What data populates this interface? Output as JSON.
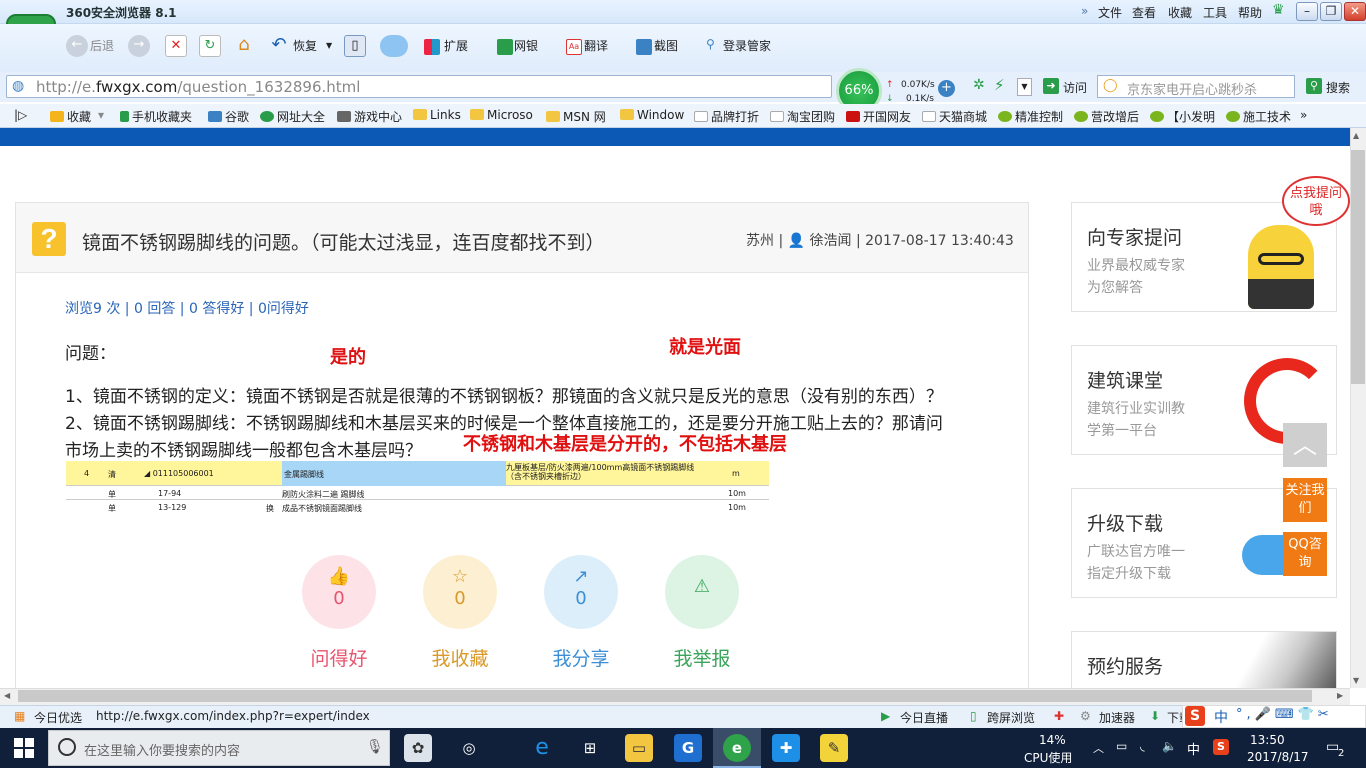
{
  "browser": {
    "app_title": "360安全浏览器 8.1",
    "logo_letter": "e",
    "menu": [
      "文件",
      "查看",
      "收藏",
      "工具",
      "帮助"
    ],
    "toolbar": {
      "back": "后退",
      "restore": "恢复",
      "extend": "扩展",
      "bank": "网银",
      "translate": "翻译",
      "screenshot": "截图",
      "login": "登录管家"
    },
    "address_prefix": "http://e.",
    "address_domain": "fwxgx.com",
    "address_path": "/question_1632896.html",
    "speed": {
      "percent": "66%",
      "up": "0.07K/s",
      "down": "0.1K/s"
    },
    "visit": "访问",
    "search_placeholder": "京东家电开启心跳秒杀",
    "search_button": "搜索",
    "bookmarks": [
      "收藏",
      "手机收藏夹",
      "谷歌",
      "网址大全",
      "游戏中心",
      "Links",
      "Microso",
      "MSN 网",
      "Window",
      "品牌打折",
      "淘宝团购",
      "开国网友",
      "天猫商城",
      "精准控制",
      "营改增后",
      "【小发明",
      "施工技术"
    ]
  },
  "question": {
    "icon_char": "?",
    "title": "镜面不锈钢踢脚线的问题。（可能太过浅显，连百度都找不到）",
    "location": "苏州",
    "author": "徐浩闻",
    "datetime": "2017-08-17 13:40:43",
    "stats": {
      "views": "浏览9 次",
      "answers": "0 回答",
      "likes": "0 答得好",
      "good": "0问得好"
    },
    "label": "问题：",
    "line1": "1、镜面不锈钢的定义：镜面不锈钢是否就是很薄的不锈钢钢板？那镜面的含义就只是反光的意思（没有别的东西）？",
    "line2": "2、镜面不锈钢踢脚线：不锈钢踢脚线和木基层买来的时候是一个整体直接施工的，还是要分开施工贴上去的？那请问",
    "line3": "市场上卖的不锈钢踢脚线一般都包含木基层吗？",
    "annotations": {
      "yes": "是的",
      "polished": "就是光面",
      "separate": "不锈钢和木基层是分开的，不包括木基层"
    },
    "sheet": {
      "header": {
        "no": "4",
        "type": "清",
        "code": "◢ 011105006001",
        "name": "金属踢脚线",
        "desc": "九厘板基层/防火漆两遍/100mm高镜面不锈钢踢脚线（含不锈钢夹槽折边）",
        "unit": "m"
      },
      "rows": [
        {
          "type": "单",
          "code": "17-94",
          "mark": "",
          "name": "刷防火涂料二遍 踢脚线",
          "unit": "10m"
        },
        {
          "type": "单",
          "code": "13-129",
          "mark": "换",
          "name": "成品不锈钢镜面踢脚线",
          "unit": "10m"
        }
      ]
    },
    "actions": [
      {
        "label": "问得好",
        "count": "0",
        "icon": "thumbs-up-icon",
        "glyph": "👍",
        "bg": "#fde3e8",
        "fg": "#e8546e"
      },
      {
        "label": "我收藏",
        "count": "0",
        "icon": "star-icon",
        "glyph": "☆",
        "bg": "#fdf0d2",
        "fg": "#d99a2a"
      },
      {
        "label": "我分享",
        "count": "0",
        "icon": "share-icon",
        "glyph": "↗",
        "bg": "#ddeefb",
        "fg": "#3c8fd6"
      },
      {
        "label": "我举报",
        "count": "",
        "icon": "warning-icon",
        "glyph": "⚠",
        "bg": "#ddf4e4",
        "fg": "#3aa55a"
      }
    ]
  },
  "sidebar": {
    "bubble": "点我提问哦",
    "cards": [
      {
        "title": "向专家提问",
        "desc1": "业界最权威专家",
        "desc2": "为您解答"
      },
      {
        "title": "建筑课堂",
        "desc1": "建筑行业实训教",
        "desc2": "学第一平台"
      },
      {
        "title": "升级下载",
        "desc1": "广联达官方唯一",
        "desc2": "指定升级下载"
      },
      {
        "title": "预约服务",
        "desc1": "",
        "desc2": ""
      }
    ],
    "float_follow": "关注我们",
    "float_qq": "QQ咨询"
  },
  "status": {
    "today": "今日优选",
    "url": "http://e.fwxgx.com/index.php?r=expert/index",
    "live": "今日直播",
    "cross_screen": "跨屏浏览",
    "accelerator": "加速器",
    "download": "下载",
    "ime": "中"
  },
  "taskbar": {
    "search_placeholder": "在这里输入你要搜索的内容",
    "cpu_percent": "14%",
    "cpu_label": "CPU使用",
    "lang": "中",
    "time": "13:50",
    "date": "2017/8/17",
    "notifications": "2"
  },
  "colors": {
    "brand_blue": "#0c59b5",
    "link_blue": "#2a65b8",
    "annotation_red": "#e01010",
    "question_yellow": "#f8c22c",
    "float_orange": "#f07b15"
  }
}
